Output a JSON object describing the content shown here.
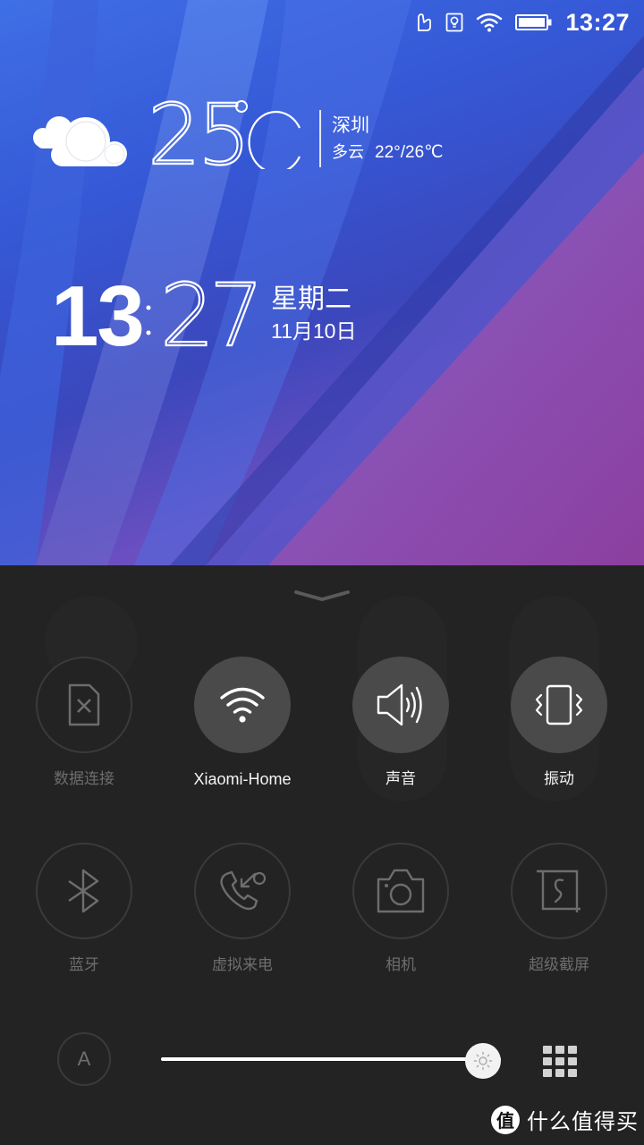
{
  "status_bar": {
    "icons": [
      "glove-mode-icon",
      "screen-lightbulb-icon",
      "wifi-icon",
      "battery-icon"
    ],
    "battery_level_percent": 95,
    "time": "13:27"
  },
  "weather": {
    "icon": "cloudy-icon",
    "temperature": "25",
    "unit": "°C",
    "city": "深圳",
    "condition": "多云",
    "range": "22°/26℃"
  },
  "clock": {
    "hour": "13",
    "minute": "27",
    "weekday": "星期二",
    "date": "11月10日"
  },
  "panel": {
    "handle_icon": "chevron-down-icon",
    "toggles": [
      {
        "id": "mobile-data",
        "label": "数据连接",
        "icon": "sim-off-icon",
        "active": false
      },
      {
        "id": "wifi",
        "label": "Xiaomi-Home",
        "icon": "wifi-icon",
        "active": true
      },
      {
        "id": "sound",
        "label": "声音",
        "icon": "speaker-icon",
        "active": true
      },
      {
        "id": "vibrate",
        "label": "振动",
        "icon": "vibrate-icon",
        "active": true
      },
      {
        "id": "bluetooth",
        "label": "蓝牙",
        "icon": "bluetooth-icon",
        "active": false
      },
      {
        "id": "fake-call",
        "label": "虚拟来电",
        "icon": "incoming-call-icon",
        "active": false
      },
      {
        "id": "camera",
        "label": "相机",
        "icon": "camera-icon",
        "active": false
      },
      {
        "id": "super-screenshot",
        "label": "超级截屏",
        "icon": "screenshot-icon",
        "active": false
      }
    ],
    "auto_brightness_label": "A",
    "brightness_percent": 100,
    "more_icon": "grid-icon"
  },
  "watermark": {
    "logo": "值",
    "text": "什么值得买"
  },
  "colors": {
    "panel_bg": "#232323",
    "tile_on_bg": "#4a4a4a",
    "tile_off_border": "#3a3a3a",
    "label_off": "#6d6d6d",
    "label_on": "#f4f4f4"
  }
}
